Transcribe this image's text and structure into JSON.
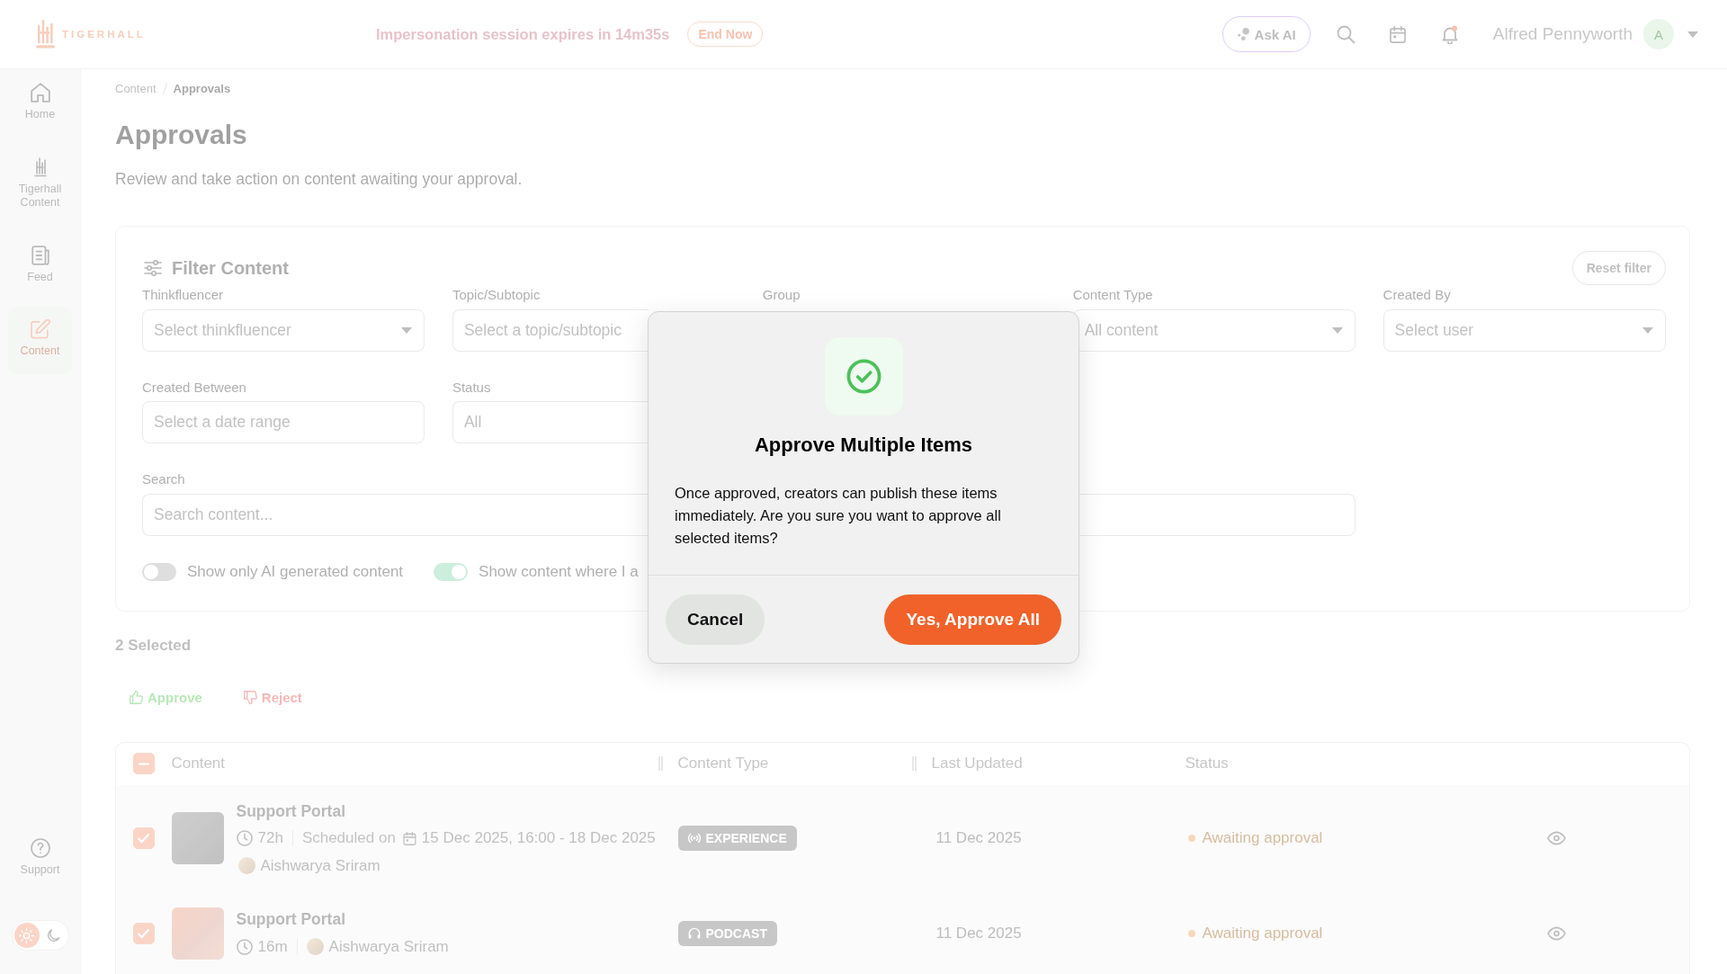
{
  "top_bar": {
    "logo_text": "TIGERHALL",
    "session_notice": "Impersonation session expires in 14m35s",
    "end_button": "End Now",
    "ask_ai_button": "Ask AI",
    "notifications_unread": true,
    "user_name": "Alfred Pennyworth",
    "avatar_initial": "A"
  },
  "sidebar": {
    "items": [
      {
        "kind": "home",
        "label": "Home",
        "selected": false
      },
      {
        "kind": "tigerhall",
        "label": "Tigerhall Content",
        "selected": false
      },
      {
        "kind": "feed",
        "label": "Feed",
        "selected": false
      },
      {
        "kind": "content",
        "label": "Content",
        "selected": true
      }
    ],
    "support": {
      "label": "Support"
    },
    "theme_options": [
      {
        "kind": "light",
        "selected": true
      },
      {
        "kind": "dark",
        "selected": false
      }
    ]
  },
  "breadcrumb": [
    {
      "label": "Content",
      "current": false
    },
    {
      "label": "Approvals",
      "current": true
    }
  ],
  "page": {
    "title": "Approvals",
    "subtitle": "Review and take action on content awaiting your approval."
  },
  "filters": {
    "title": "Filter Content",
    "reset_button": "Reset filter",
    "fields": [
      {
        "label": "Thinkfluencer",
        "field": {
          "kind": "select",
          "placeholder": "Select thinkfluencer"
        }
      },
      {
        "label": "Topic/Subtopic",
        "field": {
          "kind": "text",
          "placeholder": "Select a topic/subtopic"
        }
      },
      {
        "label": "Group"
      },
      {
        "label": "Content Type",
        "field": {
          "kind": "select",
          "placeholder": "All content"
        }
      },
      {
        "label": "Created By",
        "field": {
          "kind": "select",
          "placeholder": "Select user"
        }
      },
      {
        "label": "Created Between",
        "field": {
          "kind": "text",
          "placeholder": "Select a date range"
        }
      },
      {
        "label": "Status",
        "field": {
          "kind": "text",
          "placeholder": "All"
        }
      }
    ],
    "search": {
      "label": "Search",
      "placeholder": "Search content..."
    },
    "toggles": [
      {
        "label": "Show only AI generated content",
        "on": false
      },
      {
        "label": "Show content where I a",
        "on": true
      }
    ]
  },
  "selection": {
    "count": "2 Selected",
    "actions": [
      {
        "kind": "approve",
        "label": "Approve"
      },
      {
        "kind": "reject",
        "label": "Reject"
      }
    ]
  },
  "table": {
    "select_all": {
      "checked": false,
      "indeterminate": true
    },
    "columns": [
      {
        "label": "Content",
        "resizable": true
      },
      {
        "label": "Content Type",
        "resizable": true
      },
      {
        "label": "Last Updated",
        "resizable": false
      },
      {
        "label": "Status",
        "resizable": false
      }
    ],
    "rows": [
      {
        "checked": true,
        "title": "Support Portal",
        "duration": "72h",
        "schedule": {
          "label": "Scheduled on",
          "dates": "15 Dec 2025, 16:00 - 18 Dec 2025"
        },
        "author": "Aishwarya Sriram",
        "content_type": {
          "kind": "experience",
          "label": "EXPERIENCE"
        },
        "last_updated": "11 Dec 2025",
        "status": "Awaiting approval"
      },
      {
        "checked": true,
        "title": "Support Portal",
        "duration": "16m",
        "author": "Aishwarya Sriram",
        "content_type": {
          "kind": "podcast",
          "label": "PODCAST"
        },
        "last_updated": "11 Dec 2025",
        "status": "Awaiting approval"
      }
    ]
  },
  "dialog": {
    "title": "Approve Multiple Items",
    "message": "Once approved, creators can publish these items immediately. Are you sure you want to approve all selected items?",
    "buttons": [
      {
        "kind": "secondary",
        "label": "Cancel"
      },
      {
        "kind": "primary",
        "label": "Yes, Approve All"
      }
    ]
  }
}
